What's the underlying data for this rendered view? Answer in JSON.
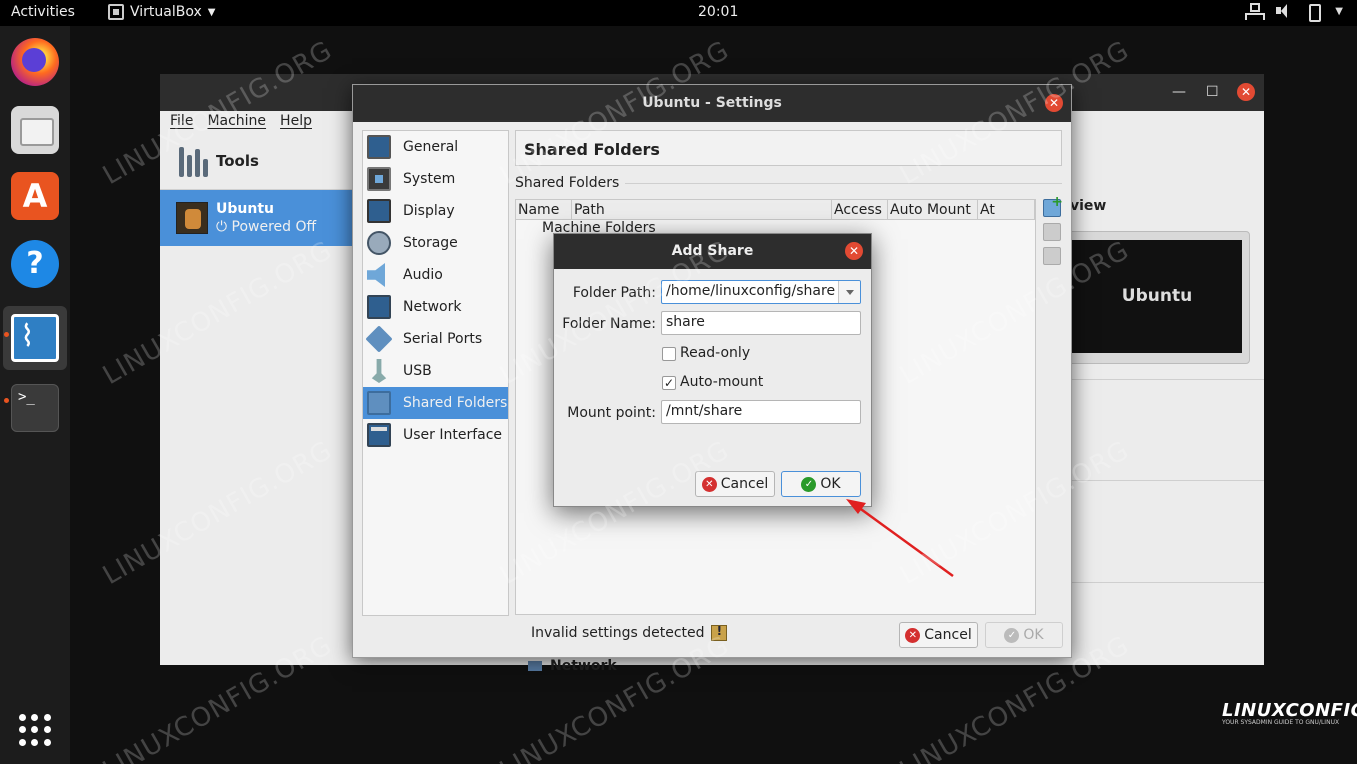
{
  "topbar": {
    "activities": "Activities",
    "app_name": "VirtualBox",
    "clock": "20:01"
  },
  "vbox_main": {
    "menus": [
      "File",
      "Machine",
      "Help"
    ],
    "tools_label": "Tools",
    "vm": {
      "name": "Ubuntu",
      "state": "Powered Off"
    },
    "preview_label": "view",
    "preview_screen_text": "Ubuntu",
    "details_section_peek": "Network"
  },
  "settings": {
    "title": "Ubuntu - Settings",
    "categories": [
      "General",
      "System",
      "Display",
      "Storage",
      "Audio",
      "Network",
      "Serial Ports",
      "USB",
      "Shared Folders",
      "User Interface"
    ],
    "selected_category": "Shared Folders",
    "page_title": "Shared Folders",
    "group_label": "Shared Folders",
    "table_columns": [
      "Name",
      "Path",
      "Access",
      "Auto Mount",
      "At"
    ],
    "table_rows": [
      "Machine Folders"
    ],
    "status": "Invalid settings detected",
    "cancel_label": "Cancel",
    "ok_label": "OK"
  },
  "add_share": {
    "title": "Add Share",
    "folder_path_label": "Folder Path:",
    "folder_path_value": "/home/linuxconfig/share",
    "folder_name_label": "Folder Name:",
    "folder_name_value": "share",
    "readonly_label": "Read-only",
    "readonly_checked": false,
    "automount_label": "Auto-mount",
    "automount_checked": true,
    "mount_point_label": "Mount point:",
    "mount_point_value": "/mnt/share",
    "cancel_label": "Cancel",
    "ok_label": "OK"
  },
  "watermark_text": "LINUXCONFIG.ORG",
  "brand": {
    "logo": "LINUXCONFIG",
    "tagline": "YOUR SYSADMIN GUIDE TO GNU/LINUX"
  },
  "colors": {
    "selection": "#4a90d9",
    "titlebar": "#2d2d2d",
    "close_button": "#e24a33",
    "annotation_arrow": "#e02020"
  }
}
